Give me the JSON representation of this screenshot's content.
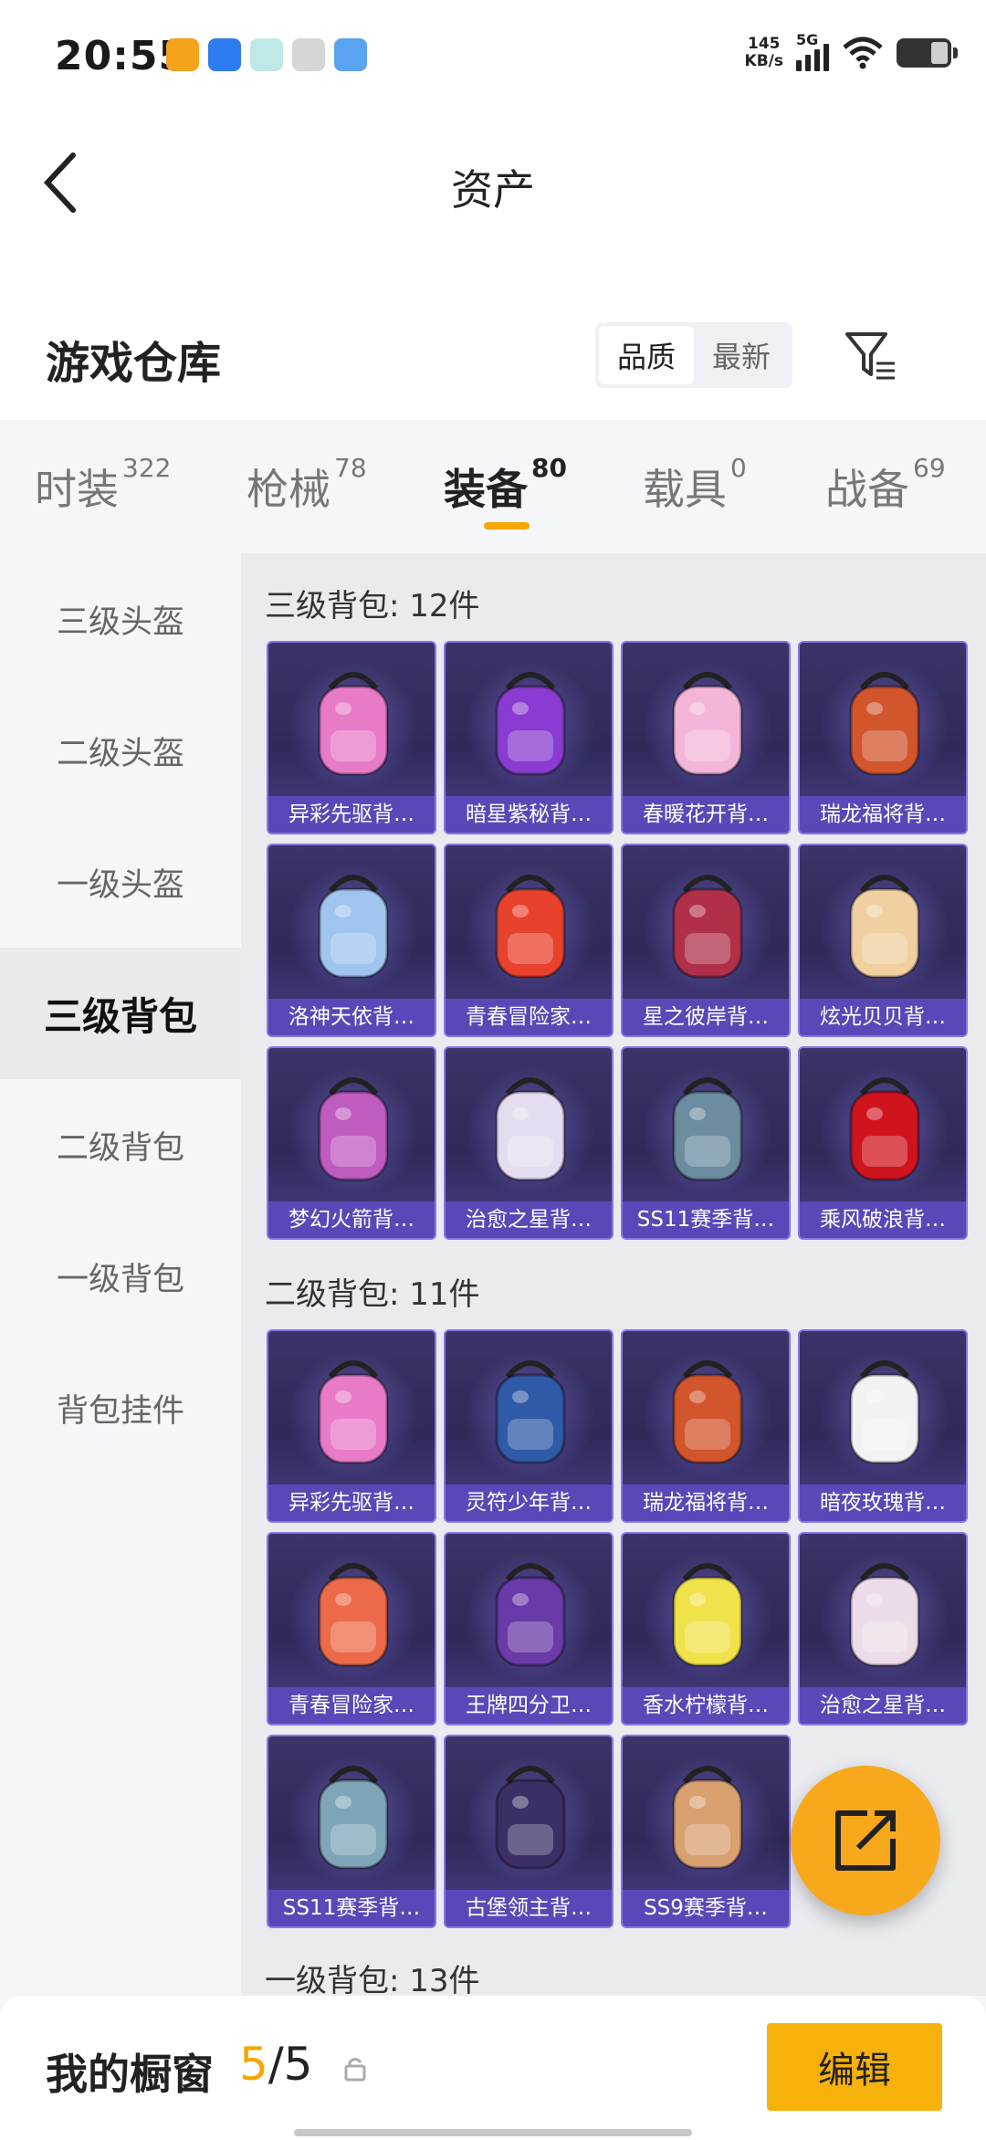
{
  "status_bar": {
    "time": "20:55",
    "net_speed_value": "145",
    "net_speed_unit": "KB/s",
    "network": "5G"
  },
  "header": {
    "title": "资产"
  },
  "warehouse": {
    "title": "游戏仓库",
    "sort_options": [
      "品质",
      "最新"
    ],
    "active_sort": "品质"
  },
  "tabs": [
    {
      "label": "时装",
      "count": "322"
    },
    {
      "label": "枪械",
      "count": "78"
    },
    {
      "label": "装备",
      "count": "80"
    },
    {
      "label": "载具",
      "count": "0"
    },
    {
      "label": "战备",
      "count": "69"
    }
  ],
  "active_tab": "装备",
  "sidebar": [
    {
      "label": "三级头盔"
    },
    {
      "label": "二级头盔"
    },
    {
      "label": "一级头盔"
    },
    {
      "label": "三级背包"
    },
    {
      "label": "二级背包"
    },
    {
      "label": "一级背包"
    },
    {
      "label": "背包挂件"
    }
  ],
  "active_sidebar": "三级背包",
  "sections": [
    {
      "title": "三级背包: 12件",
      "items": [
        {
          "name": "异彩先驱背…",
          "color": "#e87bc8"
        },
        {
          "name": "暗星紫秘背…",
          "color": "#8a3bd1"
        },
        {
          "name": "春暖花开背…",
          "color": "#f4b6d8"
        },
        {
          "name": "瑞龙福将背…",
          "color": "#d2552c"
        },
        {
          "name": "洛神天依背…",
          "color": "#9fc4ee"
        },
        {
          "name": "青春冒险家…",
          "color": "#e8412c"
        },
        {
          "name": "星之彼岸背…",
          "color": "#b0304a"
        },
        {
          "name": "炫光贝贝背…",
          "color": "#f0cfa0"
        },
        {
          "name": "梦幻火箭背…",
          "color": "#c05bc0"
        },
        {
          "name": "治愈之星背…",
          "color": "#e6dcef"
        },
        {
          "name": "SS11赛季背…",
          "color": "#6c8ca0"
        },
        {
          "name": "乘风破浪背…",
          "color": "#d0141e"
        }
      ]
    },
    {
      "title": "二级背包: 11件",
      "items": [
        {
          "name": "异彩先驱背…",
          "color": "#e87bc8"
        },
        {
          "name": "灵符少年背…",
          "color": "#2f5aa8"
        },
        {
          "name": "瑞龙福将背…",
          "color": "#d2552c"
        },
        {
          "name": "暗夜玫瑰背…",
          "color": "#f2f2f2"
        },
        {
          "name": "青春冒险家…",
          "color": "#ec6a4a"
        },
        {
          "name": "王牌四分卫…",
          "color": "#6a3aa8"
        },
        {
          "name": "香水柠檬背…",
          "color": "#f0e24a"
        },
        {
          "name": "治愈之星背…",
          "color": "#ecdce9"
        },
        {
          "name": "SS11赛季背…",
          "color": "#7fa6b8"
        },
        {
          "name": "古堡领主背…",
          "color": "#3c2f66"
        },
        {
          "name": "SS9赛季背…",
          "color": "#d9a070"
        }
      ]
    },
    {
      "title": "一级背包: 13件",
      "items": []
    }
  ],
  "bottom_bar": {
    "title": "我的橱窗",
    "count_current": "5",
    "count_sep": "/",
    "count_total": "5",
    "edit_label": "编辑"
  },
  "colors": {
    "accent": "#f7b10b",
    "card_border": "#8a74e8",
    "card_label_bg": "#5a48b8"
  }
}
